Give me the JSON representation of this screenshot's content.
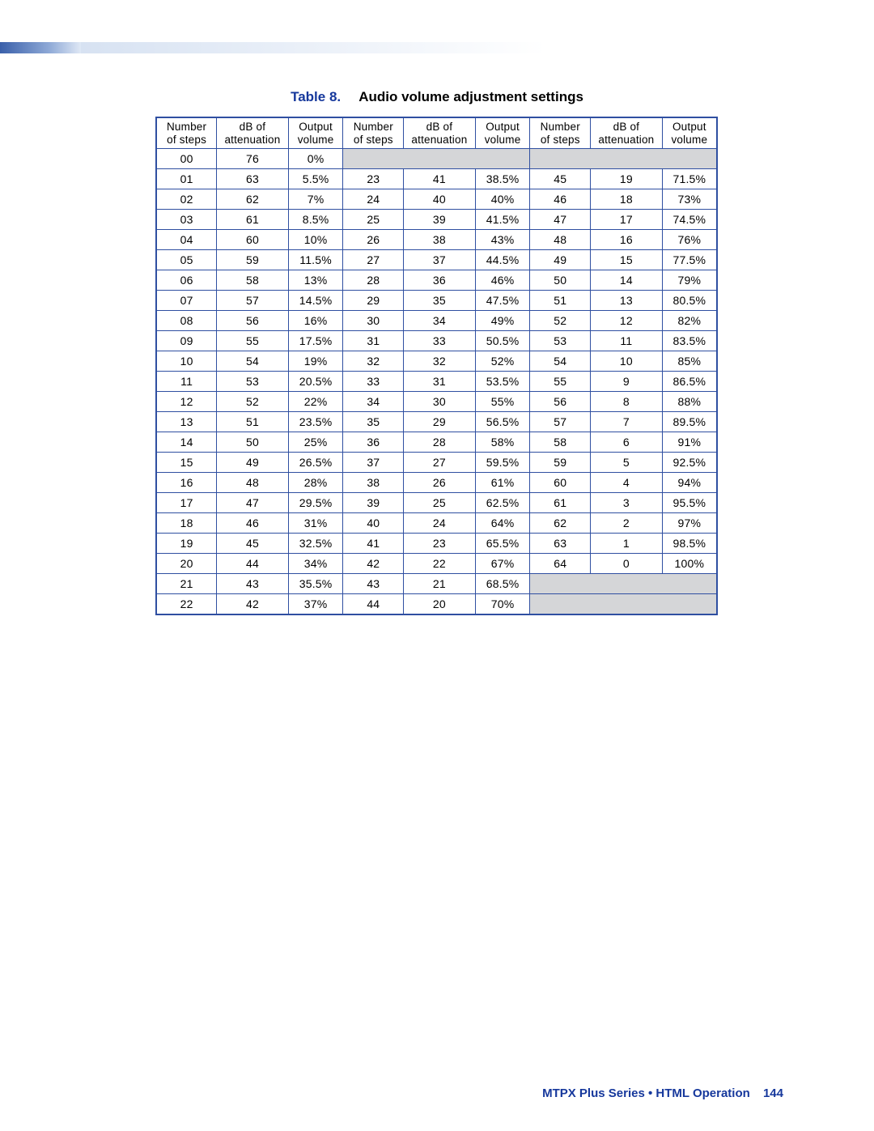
{
  "caption": {
    "label": "Table 8.",
    "title": "Audio volume adjustment settings"
  },
  "headers": {
    "h1a": "Number",
    "h1b": "of steps",
    "h2a": "dB of",
    "h2b": "attenuation",
    "h3a": "Output",
    "h3b": "volume"
  },
  "rows": [
    {
      "g1": {
        "steps": "00",
        "db": "76",
        "vol": "0%"
      },
      "g2": null,
      "g3": null
    },
    {
      "g1": {
        "steps": "01",
        "db": "63",
        "vol": "5.5%"
      },
      "g2": {
        "steps": "23",
        "db": "41",
        "vol": "38.5%"
      },
      "g3": {
        "steps": "45",
        "db": "19",
        "vol": "71.5%"
      }
    },
    {
      "g1": {
        "steps": "02",
        "db": "62",
        "vol": "7%"
      },
      "g2": {
        "steps": "24",
        "db": "40",
        "vol": "40%"
      },
      "g3": {
        "steps": "46",
        "db": "18",
        "vol": "73%"
      }
    },
    {
      "g1": {
        "steps": "03",
        "db": "61",
        "vol": "8.5%"
      },
      "g2": {
        "steps": "25",
        "db": "39",
        "vol": "41.5%"
      },
      "g3": {
        "steps": "47",
        "db": "17",
        "vol": "74.5%"
      }
    },
    {
      "g1": {
        "steps": "04",
        "db": "60",
        "vol": "10%"
      },
      "g2": {
        "steps": "26",
        "db": "38",
        "vol": "43%"
      },
      "g3": {
        "steps": "48",
        "db": "16",
        "vol": "76%"
      }
    },
    {
      "g1": {
        "steps": "05",
        "db": "59",
        "vol": "11.5%"
      },
      "g2": {
        "steps": "27",
        "db": "37",
        "vol": "44.5%"
      },
      "g3": {
        "steps": "49",
        "db": "15",
        "vol": "77.5%"
      }
    },
    {
      "g1": {
        "steps": "06",
        "db": "58",
        "vol": "13%"
      },
      "g2": {
        "steps": "28",
        "db": "36",
        "vol": "46%"
      },
      "g3": {
        "steps": "50",
        "db": "14",
        "vol": "79%"
      }
    },
    {
      "g1": {
        "steps": "07",
        "db": "57",
        "vol": "14.5%"
      },
      "g2": {
        "steps": "29",
        "db": "35",
        "vol": "47.5%"
      },
      "g3": {
        "steps": "51",
        "db": "13",
        "vol": "80.5%"
      }
    },
    {
      "g1": {
        "steps": "08",
        "db": "56",
        "vol": "16%"
      },
      "g2": {
        "steps": "30",
        "db": "34",
        "vol": "49%"
      },
      "g3": {
        "steps": "52",
        "db": "12",
        "vol": "82%"
      }
    },
    {
      "g1": {
        "steps": "09",
        "db": "55",
        "vol": "17.5%"
      },
      "g2": {
        "steps": "31",
        "db": "33",
        "vol": "50.5%"
      },
      "g3": {
        "steps": "53",
        "db": "11",
        "vol": "83.5%"
      }
    },
    {
      "g1": {
        "steps": "10",
        "db": "54",
        "vol": "19%"
      },
      "g2": {
        "steps": "32",
        "db": "32",
        "vol": "52%"
      },
      "g3": {
        "steps": "54",
        "db": "10",
        "vol": "85%"
      }
    },
    {
      "g1": {
        "steps": "11",
        "db": "53",
        "vol": "20.5%"
      },
      "g2": {
        "steps": "33",
        "db": "31",
        "vol": "53.5%"
      },
      "g3": {
        "steps": "55",
        "db": "9",
        "vol": "86.5%"
      }
    },
    {
      "g1": {
        "steps": "12",
        "db": "52",
        "vol": "22%"
      },
      "g2": {
        "steps": "34",
        "db": "30",
        "vol": "55%"
      },
      "g3": {
        "steps": "56",
        "db": "8",
        "vol": "88%"
      }
    },
    {
      "g1": {
        "steps": "13",
        "db": "51",
        "vol": "23.5%"
      },
      "g2": {
        "steps": "35",
        "db": "29",
        "vol": "56.5%"
      },
      "g3": {
        "steps": "57",
        "db": "7",
        "vol": "89.5%"
      }
    },
    {
      "g1": {
        "steps": "14",
        "db": "50",
        "vol": "25%"
      },
      "g2": {
        "steps": "36",
        "db": "28",
        "vol": "58%"
      },
      "g3": {
        "steps": "58",
        "db": "6",
        "vol": "91%"
      }
    },
    {
      "g1": {
        "steps": "15",
        "db": "49",
        "vol": "26.5%"
      },
      "g2": {
        "steps": "37",
        "db": "27",
        "vol": "59.5%"
      },
      "g3": {
        "steps": "59",
        "db": "5",
        "vol": "92.5%"
      }
    },
    {
      "g1": {
        "steps": "16",
        "db": "48",
        "vol": "28%"
      },
      "g2": {
        "steps": "38",
        "db": "26",
        "vol": "61%"
      },
      "g3": {
        "steps": "60",
        "db": "4",
        "vol": "94%"
      }
    },
    {
      "g1": {
        "steps": "17",
        "db": "47",
        "vol": "29.5%"
      },
      "g2": {
        "steps": "39",
        "db": "25",
        "vol": "62.5%"
      },
      "g3": {
        "steps": "61",
        "db": "3",
        "vol": "95.5%"
      }
    },
    {
      "g1": {
        "steps": "18",
        "db": "46",
        "vol": "31%"
      },
      "g2": {
        "steps": "40",
        "db": "24",
        "vol": "64%"
      },
      "g3": {
        "steps": "62",
        "db": "2",
        "vol": "97%"
      }
    },
    {
      "g1": {
        "steps": "19",
        "db": "45",
        "vol": "32.5%"
      },
      "g2": {
        "steps": "41",
        "db": "23",
        "vol": "65.5%"
      },
      "g3": {
        "steps": "63",
        "db": "1",
        "vol": "98.5%"
      }
    },
    {
      "g1": {
        "steps": "20",
        "db": "44",
        "vol": "34%"
      },
      "g2": {
        "steps": "42",
        "db": "22",
        "vol": "67%"
      },
      "g3": {
        "steps": "64",
        "db": "0",
        "vol": "100%"
      }
    },
    {
      "g1": {
        "steps": "21",
        "db": "43",
        "vol": "35.5%"
      },
      "g2": {
        "steps": "43",
        "db": "21",
        "vol": "68.5%"
      },
      "g3": null
    },
    {
      "g1": {
        "steps": "22",
        "db": "42",
        "vol": "37%"
      },
      "g2": {
        "steps": "44",
        "db": "20",
        "vol": "70%"
      },
      "g3": null
    }
  ],
  "footer": {
    "text": "MTPX Plus Series • HTML Operation",
    "page": "144"
  }
}
